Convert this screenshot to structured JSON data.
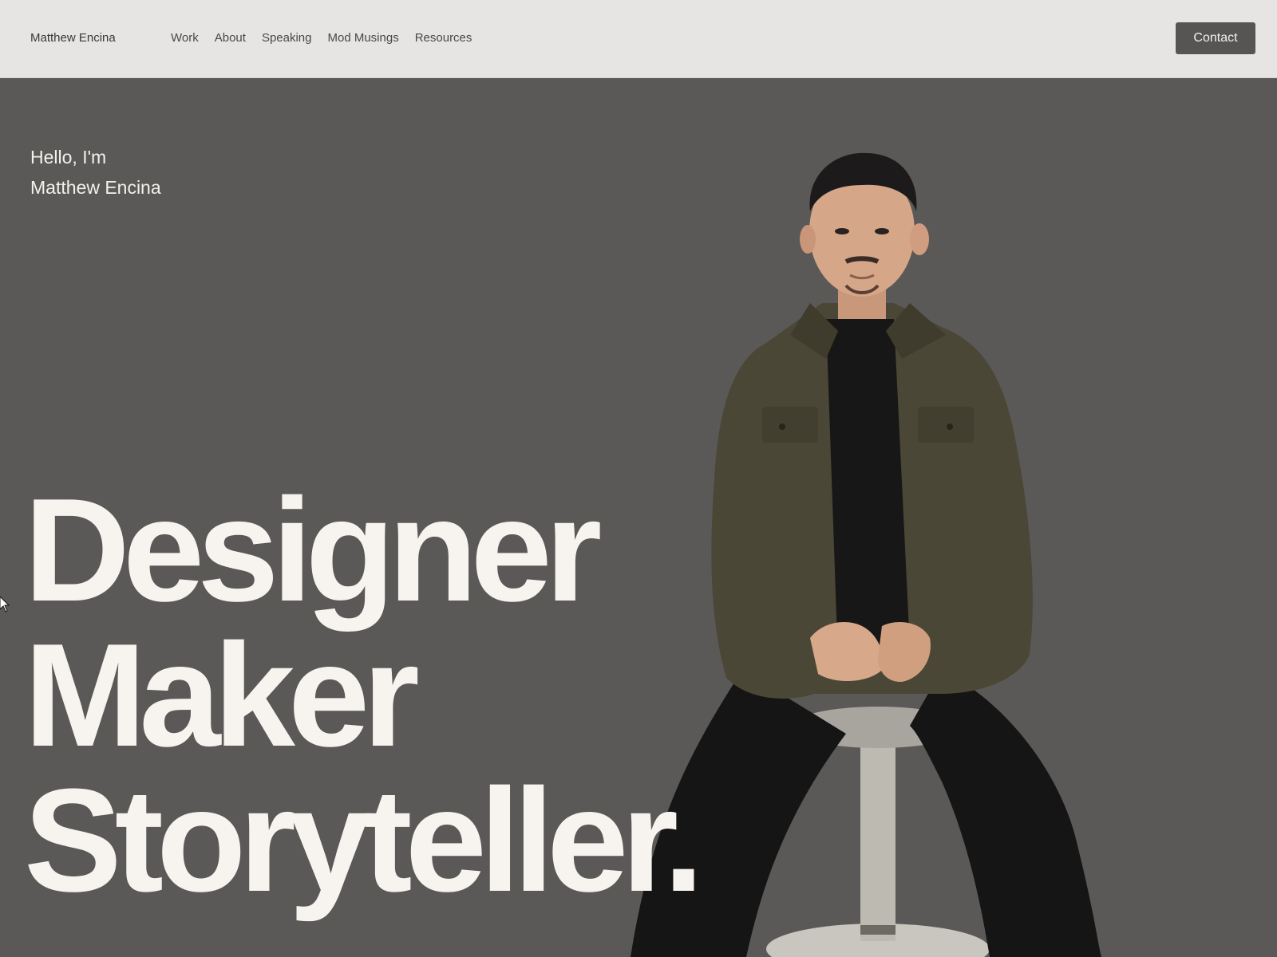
{
  "header": {
    "brand": "Matthew Encina",
    "nav": {
      "work": "Work",
      "about": "About",
      "speaking": "Speaking",
      "mod_musings": "Mod Musings",
      "resources": "Resources"
    },
    "contact_label": "Contact"
  },
  "hero": {
    "greeting_line1": "Hello, I'm",
    "greeting_line2": "Matthew Encina",
    "headline": [
      "Designer",
      "Maker",
      "Storyteller."
    ]
  },
  "colors": {
    "header_bg": "#e7e5e3",
    "hero_bg": "#5b5957",
    "contact_bg": "#575553",
    "headline_text": "#f7f4ef"
  },
  "icons": {
    "cursor": "mouse-pointer-icon"
  }
}
